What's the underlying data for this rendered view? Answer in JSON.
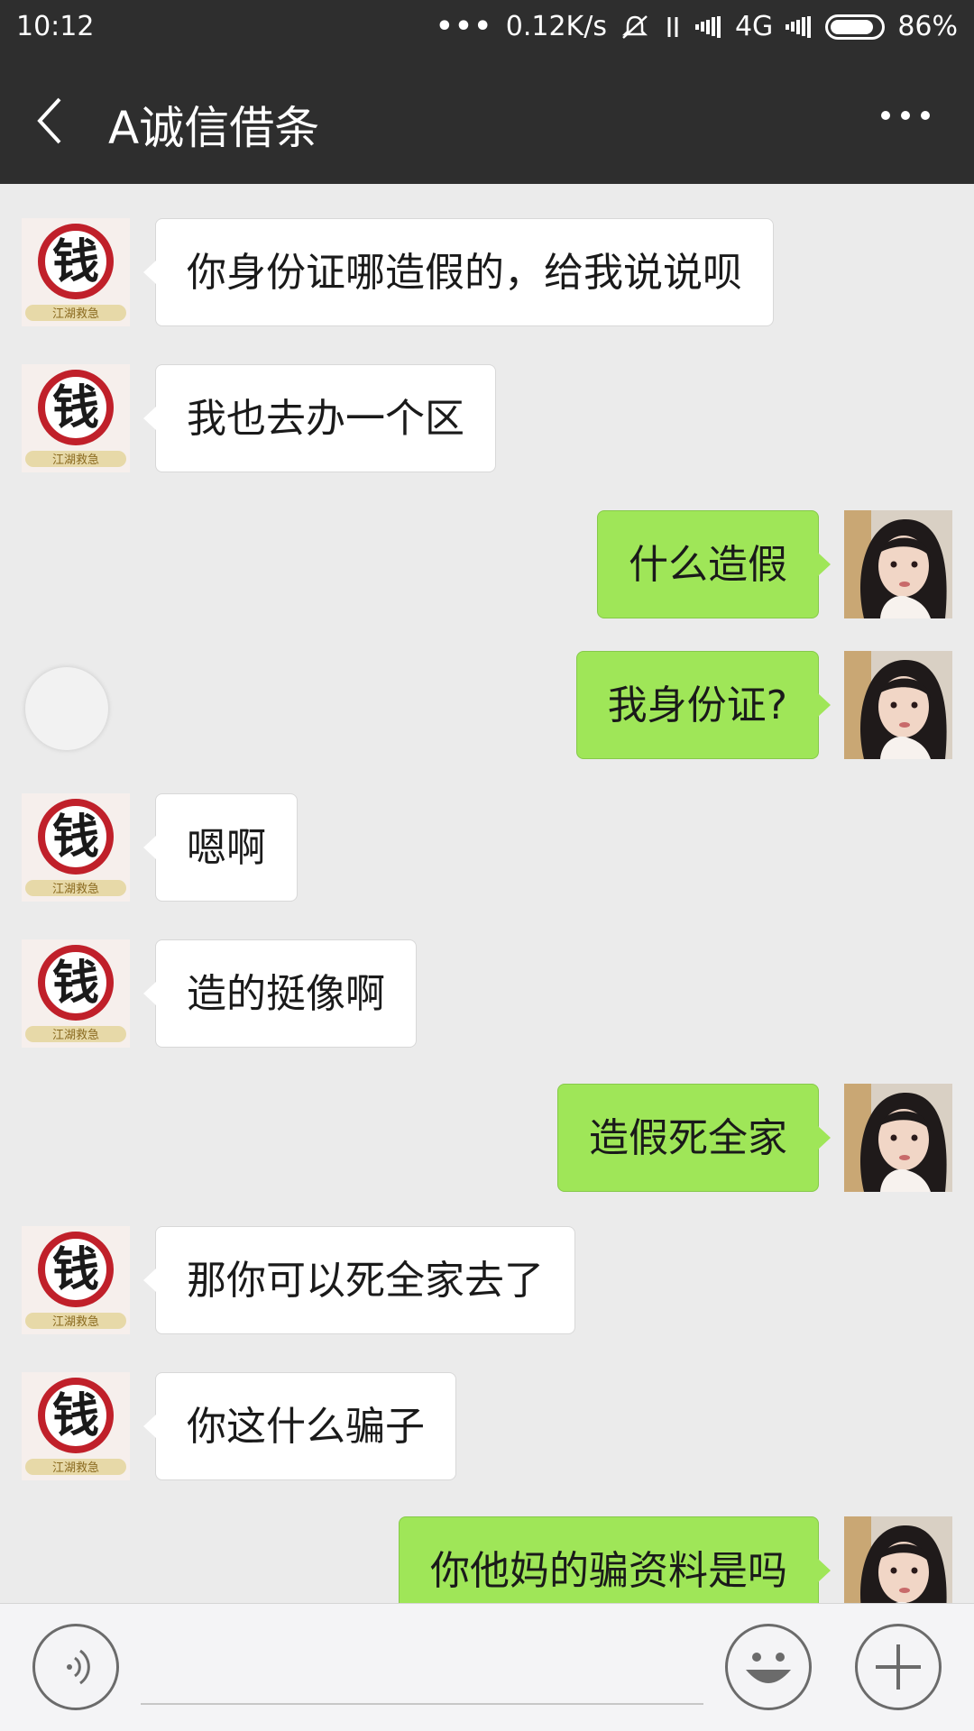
{
  "status_bar": {
    "time": "10:12",
    "speed": "0.12K/s",
    "network": "4G",
    "battery": "86%",
    "battery_level": 0.86
  },
  "header": {
    "title": "A诚信借条"
  },
  "avatars": {
    "contact": {
      "label": "钱",
      "caption": "江湖救急",
      "accent": "#c0202a"
    },
    "me": {
      "description": "girl-photo"
    }
  },
  "messages": [
    {
      "side": "left",
      "text": "你身份证哪造假的，给我说说呗"
    },
    {
      "side": "left",
      "text": "我也去办一个区"
    },
    {
      "side": "right",
      "text": "什么造假"
    },
    {
      "side": "right",
      "text": "我身份证?"
    },
    {
      "side": "left",
      "text": "嗯啊"
    },
    {
      "side": "left",
      "text": "造的挺像啊"
    },
    {
      "side": "right",
      "text": "造假死全家"
    },
    {
      "side": "left",
      "text": "那你可以死全家去了"
    },
    {
      "side": "left",
      "text": "你这什么骗子"
    },
    {
      "side": "right",
      "text": "你他妈的骗资料是吗"
    }
  ],
  "input": {
    "value": "",
    "placeholder": ""
  },
  "colors": {
    "bar": "#2e2e2e",
    "background": "#ebebeb",
    "bubble_self": "#9fe658",
    "bubble_other": "#ffffff"
  }
}
